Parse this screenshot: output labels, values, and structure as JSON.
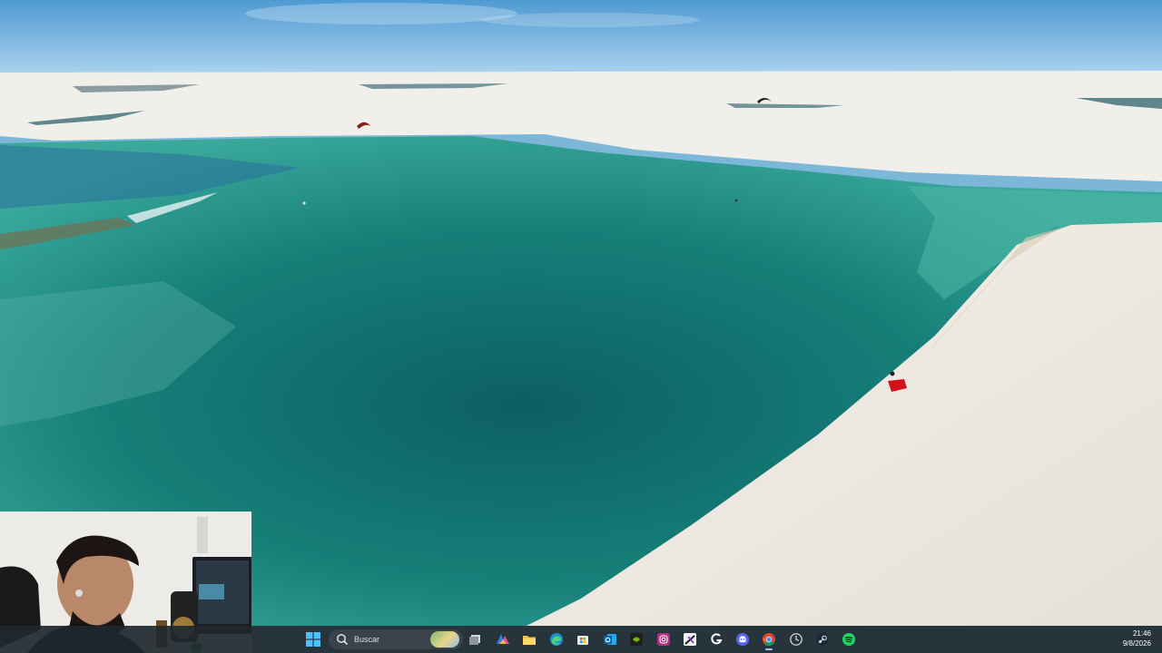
{
  "wallpaper": {
    "scene": "lagoon-dunes",
    "colors": {
      "sky": "#5ea6d8",
      "sand": "#efece5",
      "water_deep": "#0f6d6a",
      "water_light": "#2fa79a"
    }
  },
  "taskbar": {
    "search": {
      "placeholder": "Buscar",
      "icon": "search-icon"
    },
    "apps": [
      {
        "name": "windows-start",
        "icon": "windows-logo-icon"
      },
      {
        "name": "task-view",
        "icon": "task-view-icon"
      },
      {
        "name": "widgets",
        "icon": "widgets-icon"
      },
      {
        "name": "microsoft-edge",
        "icon": "edge-icon"
      },
      {
        "name": "file-explorer",
        "icon": "folder-icon"
      },
      {
        "name": "microsoft-store",
        "icon": "store-icon"
      },
      {
        "name": "outlook",
        "icon": "outlook-icon"
      },
      {
        "name": "nvidia",
        "icon": "nvidia-icon"
      },
      {
        "name": "instagram",
        "icon": "instagram-icon"
      },
      {
        "name": "capcut",
        "icon": "capcut-icon"
      },
      {
        "name": "g-hub",
        "icon": "ghub-icon"
      },
      {
        "name": "discord",
        "icon": "discord-icon"
      },
      {
        "name": "chrome",
        "icon": "chrome-icon",
        "active": true
      },
      {
        "name": "clock-app",
        "icon": "clock-icon"
      },
      {
        "name": "steam",
        "icon": "steam-icon"
      },
      {
        "name": "spotify",
        "icon": "spotify-icon"
      }
    ],
    "clock": {
      "time": "21:46",
      "date": "9/8/2026"
    }
  },
  "webcam": {
    "visible": true
  }
}
